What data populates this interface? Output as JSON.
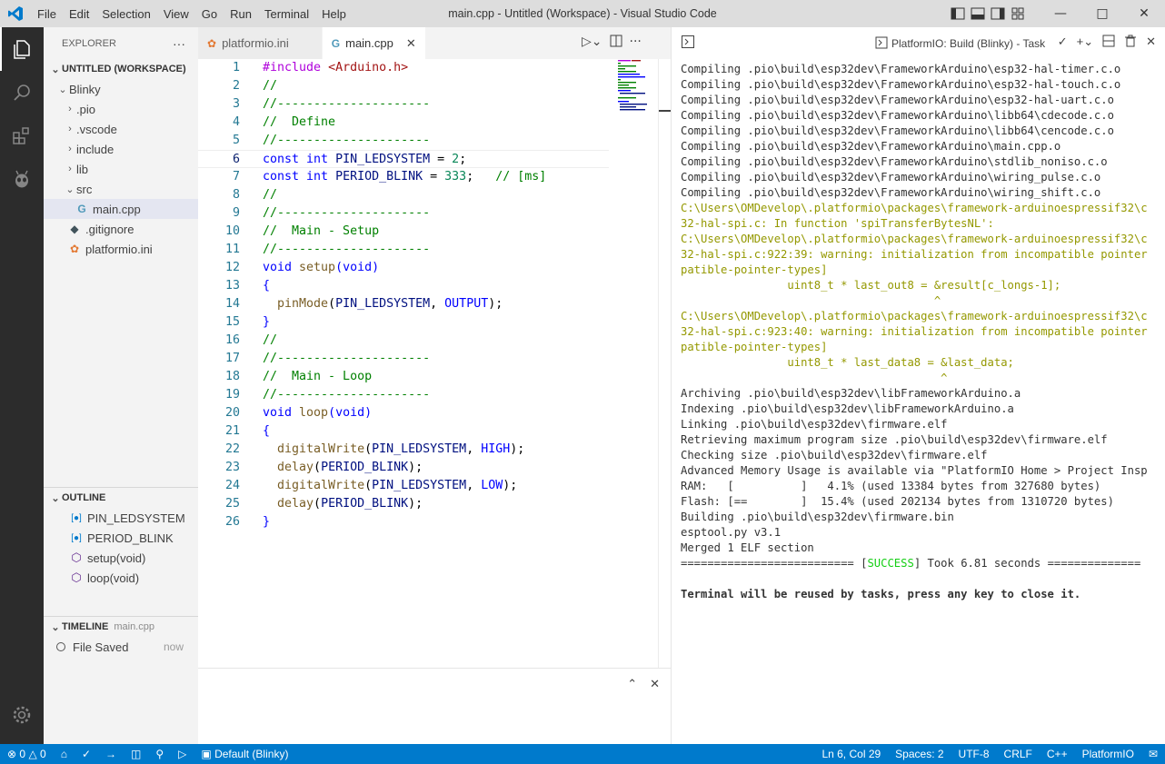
{
  "titlebar": {
    "menu": [
      "File",
      "Edit",
      "Selection",
      "View",
      "Go",
      "Run",
      "Terminal",
      "Help"
    ],
    "title": "main.cpp - Untitled (Workspace) - Visual Studio Code"
  },
  "sidebar": {
    "header": "EXPLORER",
    "workspace": "UNTITLED (WORKSPACE)",
    "tree": [
      {
        "label": "Blinky",
        "indent": 1,
        "kind": "folder-open"
      },
      {
        "label": ".pio",
        "indent": 2,
        "kind": "folder"
      },
      {
        "label": ".vscode",
        "indent": 2,
        "kind": "folder"
      },
      {
        "label": "include",
        "indent": 2,
        "kind": "folder"
      },
      {
        "label": "lib",
        "indent": 2,
        "kind": "folder"
      },
      {
        "label": "src",
        "indent": 2,
        "kind": "folder-open"
      },
      {
        "label": "main.cpp",
        "indent": 3,
        "kind": "cpp-file"
      },
      {
        "label": ".gitignore",
        "indent": 2,
        "kind": "git-file"
      },
      {
        "label": "platformio.ini",
        "indent": 2,
        "kind": "pio-file"
      }
    ],
    "outline_title": "OUTLINE",
    "outline": [
      {
        "label": "PIN_LEDSYSTEM",
        "kind": "variable"
      },
      {
        "label": "PERIOD_BLINK",
        "kind": "variable"
      },
      {
        "label": "setup(void)",
        "kind": "method"
      },
      {
        "label": "loop(void)",
        "kind": "method"
      }
    ],
    "timeline_title": "TIMELINE",
    "timeline_file": "main.cpp",
    "timeline_item": "File Saved",
    "timeline_time": "now"
  },
  "tabs": [
    {
      "label": "platformio.ini",
      "active": false
    },
    {
      "label": "main.cpp",
      "active": true
    }
  ],
  "editor": {
    "current_line": 6,
    "lines": [
      [
        [
          "pp",
          "#include "
        ],
        [
          "str",
          "<Arduino.h>"
        ]
      ],
      [
        [
          "cm",
          "//"
        ]
      ],
      [
        [
          "cm",
          "//---------------------"
        ]
      ],
      [
        [
          "cm",
          "//  Define"
        ]
      ],
      [
        [
          "cm",
          "//---------------------"
        ]
      ],
      [
        [
          "kw",
          "const int "
        ],
        [
          "id",
          "PIN_LEDSYSTEM"
        ],
        [
          "pl",
          " = "
        ],
        [
          "num",
          "2"
        ],
        [
          "pl",
          ";"
        ]
      ],
      [
        [
          "kw",
          "const int "
        ],
        [
          "id",
          "PERIOD_BLINK"
        ],
        [
          "pl",
          " = "
        ],
        [
          "num",
          "333"
        ],
        [
          "pl",
          ";   "
        ],
        [
          "cm",
          "// [ms]"
        ]
      ],
      [
        [
          "cm",
          "//"
        ]
      ],
      [
        [
          "cm",
          "//---------------------"
        ]
      ],
      [
        [
          "cm",
          "//  Main - Setup"
        ]
      ],
      [
        [
          "cm",
          "//---------------------"
        ]
      ],
      [
        [
          "kw",
          "void "
        ],
        [
          "fn",
          "setup"
        ],
        [
          "kw",
          "(void)"
        ]
      ],
      [
        [
          "kw",
          "{"
        ]
      ],
      [
        [
          "pl",
          "  "
        ],
        [
          "fn",
          "pinMode"
        ],
        [
          "pl",
          "("
        ],
        [
          "id",
          "PIN_LEDSYSTEM"
        ],
        [
          "pl",
          ", "
        ],
        [
          "kw",
          "OUTPUT"
        ],
        [
          "pl",
          ");"
        ]
      ],
      [
        [
          "kw",
          "}"
        ]
      ],
      [
        [
          "cm",
          "//"
        ]
      ],
      [
        [
          "cm",
          "//---------------------"
        ]
      ],
      [
        [
          "cm",
          "//  Main - Loop"
        ]
      ],
      [
        [
          "cm",
          "//---------------------"
        ]
      ],
      [
        [
          "kw",
          "void "
        ],
        [
          "fn",
          "loop"
        ],
        [
          "kw",
          "(void)"
        ]
      ],
      [
        [
          "kw",
          "{"
        ]
      ],
      [
        [
          "pl",
          "  "
        ],
        [
          "fn",
          "digitalWrite"
        ],
        [
          "pl",
          "("
        ],
        [
          "id",
          "PIN_LEDSYSTEM"
        ],
        [
          "pl",
          ", "
        ],
        [
          "kw",
          "HIGH"
        ],
        [
          "pl",
          ");"
        ]
      ],
      [
        [
          "pl",
          "  "
        ],
        [
          "fn",
          "delay"
        ],
        [
          "pl",
          "("
        ],
        [
          "id",
          "PERIOD_BLINK"
        ],
        [
          "pl",
          ");"
        ]
      ],
      [
        [
          "pl",
          "  "
        ],
        [
          "fn",
          "digitalWrite"
        ],
        [
          "pl",
          "("
        ],
        [
          "id",
          "PIN_LEDSYSTEM"
        ],
        [
          "pl",
          ", "
        ],
        [
          "kw",
          "LOW"
        ],
        [
          "pl",
          ");"
        ]
      ],
      [
        [
          "pl",
          "  "
        ],
        [
          "fn",
          "delay"
        ],
        [
          "pl",
          "("
        ],
        [
          "id",
          "PERIOD_BLINK"
        ],
        [
          "pl",
          ");"
        ]
      ],
      [
        [
          "kw",
          "}"
        ]
      ]
    ]
  },
  "terminal": {
    "title": "PlatformIO: Build (Blinky) - Task",
    "lines": [
      {
        "t": "Compiling .pio\\build\\esp32dev\\FrameworkArduino\\esp32-hal-timer.c.o",
        "s": ""
      },
      {
        "t": "Compiling .pio\\build\\esp32dev\\FrameworkArduino\\esp32-hal-touch.c.o",
        "s": ""
      },
      {
        "t": "Compiling .pio\\build\\esp32dev\\FrameworkArduino\\esp32-hal-uart.c.o",
        "s": ""
      },
      {
        "t": "Compiling .pio\\build\\esp32dev\\FrameworkArduino\\libb64\\cdecode.c.o",
        "s": ""
      },
      {
        "t": "Compiling .pio\\build\\esp32dev\\FrameworkArduino\\libb64\\cencode.c.o",
        "s": ""
      },
      {
        "t": "Compiling .pio\\build\\esp32dev\\FrameworkArduino\\main.cpp.o",
        "s": ""
      },
      {
        "t": "Compiling .pio\\build\\esp32dev\\FrameworkArduino\\stdlib_noniso.c.o",
        "s": ""
      },
      {
        "t": "Compiling .pio\\build\\esp32dev\\FrameworkArduino\\wiring_pulse.c.o",
        "s": ""
      },
      {
        "t": "Compiling .pio\\build\\esp32dev\\FrameworkArduino\\wiring_shift.c.o",
        "s": ""
      },
      {
        "t": "C:\\Users\\OMDevelop\\.platformio\\packages\\framework-arduinoespressif32\\c",
        "s": "warn"
      },
      {
        "t": "32-hal-spi.c: In function 'spiTransferBytesNL':",
        "s": "warn"
      },
      {
        "t": "C:\\Users\\OMDevelop\\.platformio\\packages\\framework-arduinoespressif32\\c",
        "s": "warn"
      },
      {
        "t": "32-hal-spi.c:922:39: warning: initialization from incompatible pointer",
        "s": "warn"
      },
      {
        "t": "patible-pointer-types]",
        "s": "warn"
      },
      {
        "t": "                uint8_t * last_out8 = &result[c_longs-1];",
        "s": "warn"
      },
      {
        "t": "                                      ^",
        "s": "warn"
      },
      {
        "t": "C:\\Users\\OMDevelop\\.platformio\\packages\\framework-arduinoespressif32\\c",
        "s": "warn"
      },
      {
        "t": "32-hal-spi.c:923:40: warning: initialization from incompatible pointer",
        "s": "warn"
      },
      {
        "t": "patible-pointer-types]",
        "s": "warn"
      },
      {
        "t": "                uint8_t * last_data8 = &last_data;",
        "s": "warn"
      },
      {
        "t": "                                       ^",
        "s": "warn"
      },
      {
        "t": "Archiving .pio\\build\\esp32dev\\libFrameworkArduino.a",
        "s": ""
      },
      {
        "t": "Indexing .pio\\build\\esp32dev\\libFrameworkArduino.a",
        "s": ""
      },
      {
        "t": "Linking .pio\\build\\esp32dev\\firmware.elf",
        "s": ""
      },
      {
        "t": "Retrieving maximum program size .pio\\build\\esp32dev\\firmware.elf",
        "s": ""
      },
      {
        "t": "Checking size .pio\\build\\esp32dev\\firmware.elf",
        "s": ""
      },
      {
        "t": "Advanced Memory Usage is available via \"PlatformIO Home > Project Insp",
        "s": ""
      },
      {
        "t": "RAM:   [          ]   4.1% (used 13384 bytes from 327680 bytes)",
        "s": ""
      },
      {
        "t": "Flash: [==        ]  15.4% (used 202134 bytes from 1310720 bytes)",
        "s": ""
      },
      {
        "t": "Building .pio\\build\\esp32dev\\firmware.bin",
        "s": ""
      },
      {
        "t": "esptool.py v3.1",
        "s": ""
      },
      {
        "t": "Merged 1 ELF section",
        "s": ""
      },
      {
        "t": "SUCCESS",
        "s": "success",
        "pre": "========================== [",
        "post": "] Took 6.81 seconds =============="
      },
      {
        "t": "",
        "s": ""
      },
      {
        "t": "Terminal will be reused by tasks, press any key to close it.",
        "s": "bold"
      }
    ]
  },
  "statusbar": {
    "errors": "0",
    "warnings": "0",
    "env": "Default (Blinky)",
    "position": "Ln 6, Col 29",
    "spaces": "Spaces: 2",
    "encoding": "UTF-8",
    "eol": "CRLF",
    "language": "C++",
    "ext": "PlatformIO"
  },
  "colors": {
    "accent": "#007acc",
    "activitybar": "#2c2c2c",
    "titlebar": "#dddddd"
  }
}
